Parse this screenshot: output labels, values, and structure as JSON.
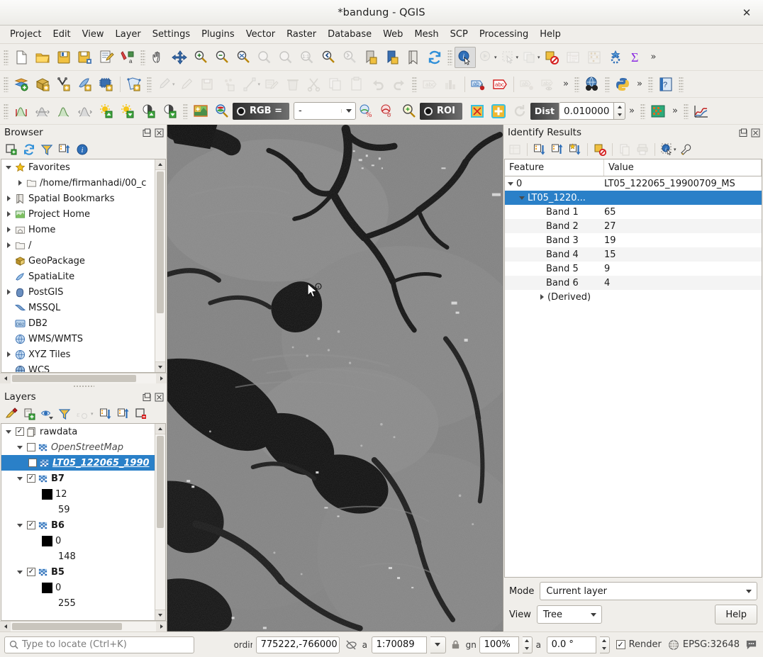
{
  "window": {
    "title": "*bandung - QGIS",
    "close_label": "✕"
  },
  "menubar": {
    "items": [
      {
        "label": "Project"
      },
      {
        "label": "Edit"
      },
      {
        "label": "View"
      },
      {
        "label": "Layer"
      },
      {
        "label": "Settings"
      },
      {
        "label": "Plugins"
      },
      {
        "label": "Vector"
      },
      {
        "label": "Raster"
      },
      {
        "label": "Database"
      },
      {
        "label": "Web"
      },
      {
        "label": "Mesh"
      },
      {
        "label": "SCP"
      },
      {
        "label": "Processing"
      },
      {
        "label": "Help"
      }
    ]
  },
  "toolbar_project": {
    "overflow_label": "»",
    "icons": [
      "new-project-icon",
      "open-project-icon",
      "save-project-icon",
      "save-project-as-icon",
      "new-print-layout-icon",
      "style-manager-icon",
      "pan-map-icon",
      "pan-to-selection-icon",
      "zoom-in-icon",
      "zoom-out-icon",
      "zoom-full-icon",
      "zoom-to-selection-icon",
      "zoom-to-layer-icon",
      "zoom-native-icon",
      "zoom-last-icon",
      "zoom-next-icon",
      "new-bookmark-icon",
      "show-bookmarks-icon",
      "bookmark-manager-icon",
      "refresh-icon",
      "identify-features-icon",
      "run-feature-action-icon",
      "select-features-icon",
      "deselect-features-icon",
      "deselect-all-icon",
      "open-attribute-table-icon",
      "statistical-summary-icon",
      "measure-icon",
      "options-icon",
      "sum-icon"
    ]
  },
  "toolbar_digitize": {
    "overflow_label": "»",
    "icons": [
      "add-vector-layer-icon",
      "add-raster-layer-icon",
      "add-delimited-text-layer-icon",
      "add-spatialite-layer-icon",
      "add-postgis-layer-icon",
      "new-shapefile-layer-icon",
      "current-edits-icon",
      "toggle-editing-icon",
      "save-layer-edits-icon",
      "add-feature-icon",
      "vertex-tool-icon",
      "modify-attributes-icon",
      "delete-selected-icon",
      "cut-features-icon",
      "copy-features-icon",
      "paste-features-icon",
      "undo-icon",
      "redo-icon",
      "label-icon",
      "diagram-icon",
      "pin-labels-icon",
      "highlight-labels-icon",
      "move-label-icon",
      "hide-labels-icon",
      "metasearch-icon",
      "python-console-icon",
      "help-icon"
    ]
  },
  "toolbar_scp": {
    "rgb_label": "RGB =",
    "rgb_value": "-",
    "roi_label": "ROI",
    "dist_label": "Dist",
    "dist_value": "0.010000",
    "overflow_label": "»",
    "icons": [
      "band-calc-min-icon",
      "band-calc-range-icon",
      "band-calc-max-icon",
      "band-calc-stretch-icon",
      "brightness-up-icon",
      "brightness-down-icon",
      "contrast-up-icon",
      "contrast-down-icon",
      "scp-working-toolbar-icon",
      "scp-zoom-preview-icon",
      "scp-rgb-dot-icon",
      "scp-vector-overlay-icon",
      "scp-sigma-overlay-icon",
      "scp-zoom-roi-icon",
      "scp-roi-dot-icon",
      "scp-create-roi-icon",
      "scp-add-roi-icon",
      "scp-undo-roi-icon",
      "scp-classification-preview-icon",
      "scp-spectral-plot-icon"
    ]
  },
  "browser_panel": {
    "title": "Browser",
    "panel_buttons": [
      "undock-icon",
      "close-icon"
    ],
    "toolbar_icons": [
      "add-layer-icon",
      "refresh-icon",
      "filter-browser-icon",
      "collapse-all-icon",
      "properties-info-icon"
    ],
    "tree": [
      {
        "label": "Favorites",
        "icon": "star-icon",
        "twisty": "down",
        "indent": 0
      },
      {
        "label": "/home/firmanhadi/00_c",
        "icon": "folder-icon",
        "twisty": "right",
        "indent": 1
      },
      {
        "label": "Spatial Bookmarks",
        "icon": "bookmarks-icon",
        "twisty": "right",
        "indent": 0
      },
      {
        "label": "Project Home",
        "icon": "project-home-icon",
        "twisty": "right",
        "indent": 0
      },
      {
        "label": "Home",
        "icon": "home-icon",
        "twisty": "right",
        "indent": 0
      },
      {
        "label": "/",
        "icon": "folder-icon",
        "twisty": "right",
        "indent": 0
      },
      {
        "label": "GeoPackage",
        "icon": "geopackage-icon",
        "twisty": "none",
        "indent": 0
      },
      {
        "label": "SpatiaLite",
        "icon": "spatialite-icon",
        "twisty": "none",
        "indent": 0
      },
      {
        "label": "PostGIS",
        "icon": "postgis-icon",
        "twisty": "right",
        "indent": 0
      },
      {
        "label": "MSSQL",
        "icon": "mssql-icon",
        "twisty": "none",
        "indent": 0
      },
      {
        "label": "DB2",
        "icon": "db2-icon",
        "twisty": "none",
        "indent": 0
      },
      {
        "label": "WMS/WMTS",
        "icon": "wms-icon",
        "twisty": "none",
        "indent": 0
      },
      {
        "label": "XYZ Tiles",
        "icon": "xyz-tiles-icon",
        "twisty": "right",
        "indent": 0
      },
      {
        "label": "WCS",
        "icon": "wcs-icon",
        "twisty": "none",
        "indent": 0
      }
    ]
  },
  "layers_panel": {
    "title": "Layers",
    "panel_buttons": [
      "undock-icon",
      "close-icon"
    ],
    "toolbar_icons": [
      "open-layer-styling-icon",
      "add-group-icon",
      "manage-visibility-icon",
      "filter-legend-icon",
      "edit-expression-icon",
      "expand-all-icon",
      "collapse-all-icon",
      "remove-layer-icon"
    ],
    "tree": [
      {
        "label": "rawdata",
        "indent": 0,
        "twisty": "down",
        "check": "checked",
        "icon": "group-icon",
        "style": "normal",
        "selected": false
      },
      {
        "label": "OpenStreetMap",
        "indent": 1,
        "twisty": "down",
        "check": "unchecked",
        "icon": "raster-icon",
        "style": "italic",
        "selected": false
      },
      {
        "label": "LT05_122065_1990",
        "indent": 2,
        "twisty": "none",
        "check": "unchecked",
        "icon": "raster-icon",
        "style": "bold-italic",
        "selected": true
      },
      {
        "label": "B7",
        "indent": 1,
        "twisty": "down",
        "check": "checked",
        "icon": "raster-icon",
        "style": "bold",
        "selected": false
      },
      {
        "label": "12",
        "indent": 2,
        "twisty": "none",
        "check": "none",
        "icon": "black-swatch-icon",
        "style": "normal",
        "selected": false
      },
      {
        "label": "59",
        "indent": 2,
        "twisty": "none",
        "check": "none",
        "icon": "none",
        "style": "normal",
        "selected": false
      },
      {
        "label": "B6",
        "indent": 1,
        "twisty": "down",
        "check": "checked",
        "icon": "raster-icon",
        "style": "bold",
        "selected": false
      },
      {
        "label": "0",
        "indent": 2,
        "twisty": "none",
        "check": "none",
        "icon": "black-swatch-icon",
        "style": "normal",
        "selected": false
      },
      {
        "label": "148",
        "indent": 2,
        "twisty": "none",
        "check": "none",
        "icon": "none",
        "style": "normal",
        "selected": false
      },
      {
        "label": "B5",
        "indent": 1,
        "twisty": "down",
        "check": "checked",
        "icon": "raster-icon",
        "style": "bold",
        "selected": false
      },
      {
        "label": "0",
        "indent": 2,
        "twisty": "none",
        "check": "none",
        "icon": "black-swatch-icon",
        "style": "normal",
        "selected": false
      },
      {
        "label": "255",
        "indent": 2,
        "twisty": "none",
        "check": "none",
        "icon": "none",
        "style": "normal",
        "selected": false
      }
    ]
  },
  "identify_panel": {
    "title": "Identify Results",
    "panel_buttons": [
      "undock-icon",
      "close-icon"
    ],
    "toolbar_icons": [
      "expand-new-icon",
      "expand-all-icon",
      "collapse-all-icon",
      "highlight-all-icon",
      "clear-results-icon",
      "copy-icon",
      "print-icon",
      "identify-mode-icon",
      "settings-wrench-icon"
    ],
    "columns": [
      "Feature",
      "Value"
    ],
    "rows": [
      {
        "feature": "0",
        "value": "LT05_122065_19900709_MS",
        "indent": 0,
        "twisty": "down",
        "selected": false
      },
      {
        "feature": "LT05_1220...",
        "value": "",
        "indent": 1,
        "twisty": "down",
        "selected": true
      },
      {
        "feature": "Band 1",
        "value": "65",
        "indent": 2,
        "twisty": "none",
        "selected": false
      },
      {
        "feature": "Band 2",
        "value": "27",
        "indent": 2,
        "twisty": "none",
        "selected": false
      },
      {
        "feature": "Band 3",
        "value": "19",
        "indent": 2,
        "twisty": "none",
        "selected": false
      },
      {
        "feature": "Band 4",
        "value": "15",
        "indent": 2,
        "twisty": "none",
        "selected": false
      },
      {
        "feature": "Band 5",
        "value": "9",
        "indent": 2,
        "twisty": "none",
        "selected": false
      },
      {
        "feature": "Band 6",
        "value": "4",
        "indent": 2,
        "twisty": "none",
        "selected": false
      },
      {
        "feature": "(Derived)",
        "value": "",
        "indent": 1,
        "twisty": "right",
        "selected": false
      }
    ],
    "mode_label": "Mode",
    "mode_value": "Current layer",
    "view_label": "View",
    "view_value": "Tree",
    "help_label": "Help"
  },
  "statusbar": {
    "locate_placeholder": "Type to locate (Ctrl+K)",
    "coordinate_label": "ordir",
    "coordinate_value": "775222,-766000",
    "scale_label": "a",
    "scale_value": "1:70089",
    "magnifier_label": "gn",
    "magnifier_value": "100%",
    "rotation_label": "a",
    "rotation_value": "0.0 °",
    "render_label": "Render",
    "render_checked": true,
    "crs_label": "EPSG:32648",
    "messages_icon": "messages-icon"
  },
  "colors": {
    "selection_blue": "#2a80c8",
    "panel_bg": "#f0eeea",
    "border": "#b5b1a9",
    "text": "#1a1a1a"
  }
}
